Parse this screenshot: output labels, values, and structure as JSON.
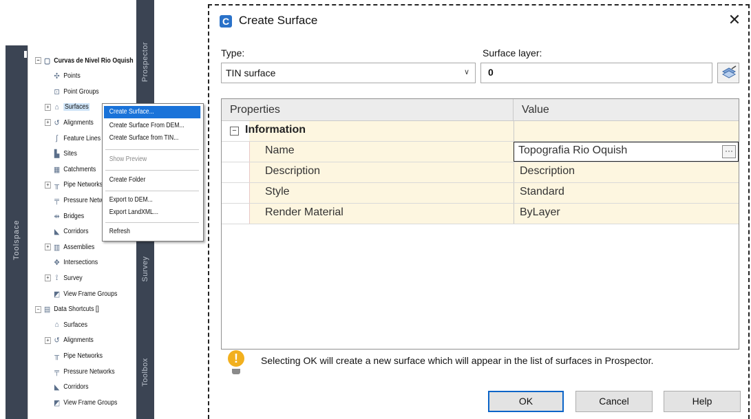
{
  "toolspace": {
    "vertical_label": "Toolspace",
    "side_tabs": [
      "Prospector",
      "Survey",
      "Toolbox"
    ],
    "tree": [
      {
        "label": "Curvas de Nivel Rio Oquish",
        "level": 0,
        "expander": "-",
        "icon": "drawing-icon",
        "bold": true
      },
      {
        "label": "Points",
        "level": 1,
        "expander": "",
        "icon": "points-icon"
      },
      {
        "label": "Point Groups",
        "level": 1,
        "expander": "",
        "icon": "point-groups-icon"
      },
      {
        "label": "Surfaces",
        "level": 1,
        "expander": "+",
        "icon": "surfaces-icon",
        "selected": true
      },
      {
        "label": "Alignments",
        "level": 1,
        "expander": "+",
        "icon": "alignments-icon"
      },
      {
        "label": "Feature Lines",
        "level": 1,
        "expander": "",
        "icon": "feature-lines-icon"
      },
      {
        "label": "Sites",
        "level": 1,
        "expander": "",
        "icon": "sites-icon"
      },
      {
        "label": "Catchments",
        "level": 1,
        "expander": "",
        "icon": "catchments-icon"
      },
      {
        "label": "Pipe Networks",
        "level": 1,
        "expander": "+",
        "icon": "pipe-networks-icon"
      },
      {
        "label": "Pressure Networks",
        "level": 1,
        "expander": "",
        "icon": "pressure-networks-icon"
      },
      {
        "label": "Bridges",
        "level": 1,
        "expander": "",
        "icon": "bridges-icon"
      },
      {
        "label": "Corridors",
        "level": 1,
        "expander": "",
        "icon": "corridors-icon"
      },
      {
        "label": "Assemblies",
        "level": 1,
        "expander": "+",
        "icon": "assemblies-icon"
      },
      {
        "label": "Intersections",
        "level": 1,
        "expander": "",
        "icon": "intersections-icon"
      },
      {
        "label": "Survey",
        "level": 1,
        "expander": "+",
        "icon": "survey-icon"
      },
      {
        "label": "View Frame Groups",
        "level": 1,
        "expander": "",
        "icon": "view-frame-groups-icon"
      },
      {
        "label": "Data Shortcuts []",
        "level": 0,
        "expander": "-",
        "icon": "data-shortcuts-icon"
      },
      {
        "label": "Surfaces",
        "level": 1,
        "expander": "",
        "icon": "surfaces-icon"
      },
      {
        "label": "Alignments",
        "level": 1,
        "expander": "+",
        "icon": "alignments-icon"
      },
      {
        "label": "Pipe Networks",
        "level": 1,
        "expander": "",
        "icon": "pipe-networks-icon"
      },
      {
        "label": "Pressure Networks",
        "level": 1,
        "expander": "",
        "icon": "pressure-networks-icon"
      },
      {
        "label": "Corridors",
        "level": 1,
        "expander": "",
        "icon": "corridors-icon"
      },
      {
        "label": "View Frame Groups",
        "level": 1,
        "expander": "",
        "icon": "view-frame-groups-icon"
      }
    ],
    "context_menu": [
      {
        "label": "Create Surface...",
        "state": "active"
      },
      {
        "label": "Create Surface From DEM...",
        "state": "normal"
      },
      {
        "label": "Create Surface from TIN...",
        "state": "normal"
      },
      {
        "label": "Show Preview",
        "state": "disabled"
      },
      {
        "label": "Create Folder",
        "state": "normal"
      },
      {
        "label": "Export to DEM...",
        "state": "normal"
      },
      {
        "label": "Export LandXML...",
        "state": "normal"
      },
      {
        "label": "Refresh",
        "state": "normal"
      }
    ]
  },
  "dialog": {
    "title": "Create Surface",
    "type_label": "Type:",
    "type_value": "TIN surface",
    "layer_label": "Surface layer:",
    "layer_value": "0",
    "grid": {
      "header_properties": "Properties",
      "header_value": "Value",
      "section": "Information",
      "rows": [
        {
          "property": "Name",
          "value": "Topografia Rio Oquish"
        },
        {
          "property": "Description",
          "value": "Description"
        },
        {
          "property": "Style",
          "value": "Standard"
        },
        {
          "property": "Render Material",
          "value": "ByLayer"
        }
      ]
    },
    "message": "Selecting OK will create a new surface which will appear in the list of surfaces in Prospector.",
    "buttons": {
      "ok": "OK",
      "cancel": "Cancel",
      "help": "Help"
    }
  },
  "colors": {
    "accent": "#0a64c8",
    "menu_highlight": "#1a73d9",
    "grid_cell": "#fdf6e0",
    "dark_panel": "#3b4453"
  }
}
